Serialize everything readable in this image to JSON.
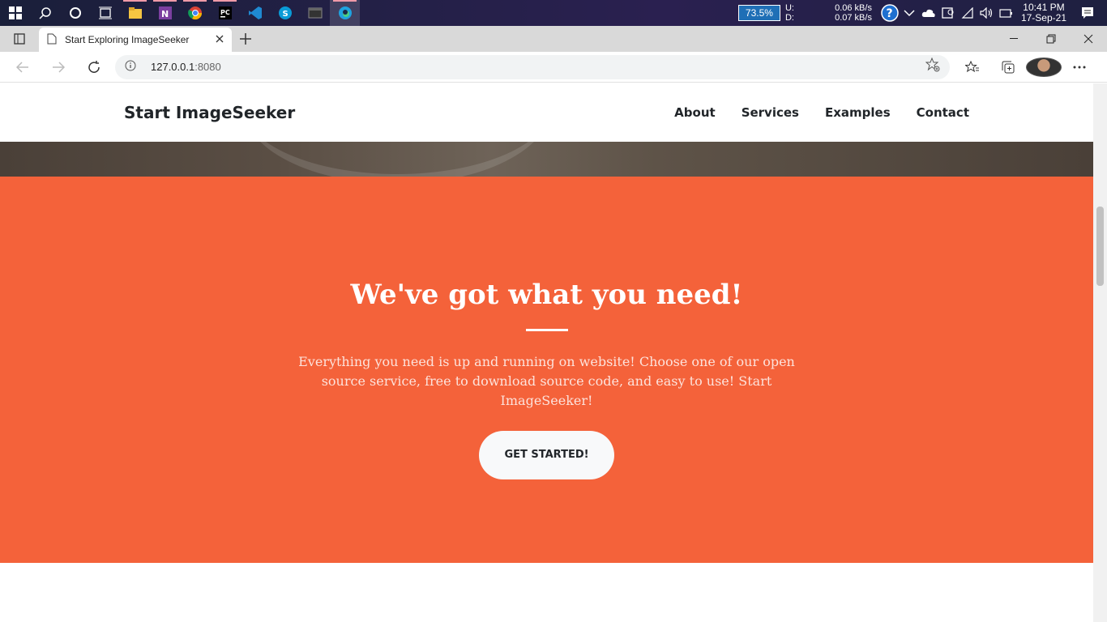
{
  "taskbar": {
    "battery": "73.5%",
    "net_up_label": "U:",
    "net_down_label": "D:",
    "net_up": "0.06 kB/s",
    "net_down": "0.07 kB/s",
    "time": "10:41 PM",
    "date": "17-Sep-21",
    "apps": [
      "windows-start",
      "search",
      "cortana",
      "task-view",
      "file-explorer",
      "onenote",
      "chrome",
      "pycharm",
      "vscode",
      "skype",
      "terminal",
      "edge"
    ]
  },
  "browser": {
    "tab_title": "Start Exploring ImageSeeker",
    "url_host": "127.0.0.1",
    "url_port": ":8080"
  },
  "site": {
    "brand": "Start ImageSeeker",
    "nav": [
      "About",
      "Services",
      "Examples",
      "Contact"
    ]
  },
  "about": {
    "heading": "We've got what you need!",
    "text": "Everything you need is up and running on website! Choose one of our open source service, free to download source code, and easy to use! Start ImageSeeker!",
    "button": "GET STARTED!"
  },
  "colors": {
    "accent": "#f4623a",
    "button_bg": "#f8f9fa",
    "text_dark": "#212529"
  }
}
